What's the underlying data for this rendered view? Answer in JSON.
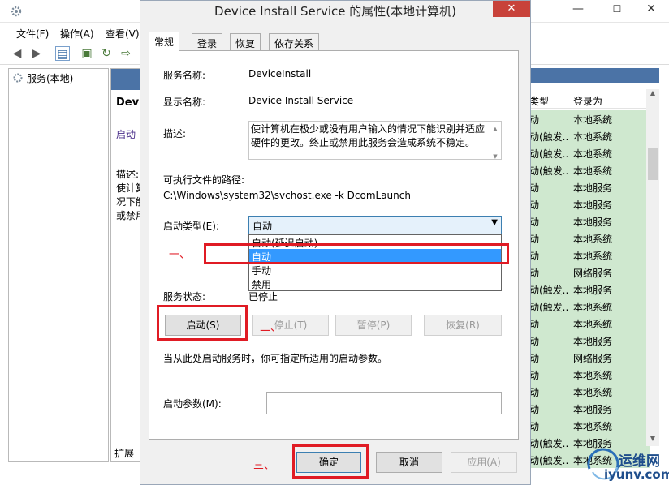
{
  "background_window": {
    "menus": [
      "文件(F)",
      "操作(A)",
      "查看(V)"
    ],
    "tree_item": "服务(本地)",
    "center_title": "Devi",
    "center_link": "启动",
    "center_desc": [
      "描述:",
      "使计算",
      "况下能",
      "或禁用"
    ],
    "extended_tab": "扩展",
    "columns": {
      "type": "类型",
      "logon": "登录为"
    },
    "rows": [
      {
        "type": "动",
        "logon": "本地系统"
      },
      {
        "type": "动(触发...",
        "logon": "本地系统"
      },
      {
        "type": "动(触发...",
        "logon": "本地系统"
      },
      {
        "type": "动(触发...",
        "logon": "本地系统"
      },
      {
        "type": "动",
        "logon": "本地服务"
      },
      {
        "type": "动",
        "logon": "本地服务"
      },
      {
        "type": "动",
        "logon": "本地服务"
      },
      {
        "type": "动",
        "logon": "本地系统"
      },
      {
        "type": "动",
        "logon": "本地系统"
      },
      {
        "type": "动",
        "logon": "网络服务"
      },
      {
        "type": "动(触发...",
        "logon": "本地服务"
      },
      {
        "type": "动(触发...",
        "logon": "本地系统"
      },
      {
        "type": "动",
        "logon": "本地系统"
      },
      {
        "type": "动",
        "logon": "本地服务"
      },
      {
        "type": "动",
        "logon": "网络服务"
      },
      {
        "type": "动",
        "logon": "本地系统"
      },
      {
        "type": "动",
        "logon": "本地系统"
      },
      {
        "type": "动",
        "logon": "本地服务"
      },
      {
        "type": "动",
        "logon": "本地系统"
      },
      {
        "type": "动(触发...",
        "logon": "本地服务"
      },
      {
        "type": "动(触发...",
        "logon": "本地系统"
      }
    ]
  },
  "dialog": {
    "title": "Device Install Service 的属性(本地计算机)",
    "close": "✕",
    "tabs": [
      "常规",
      "登录",
      "恢复",
      "依存关系"
    ],
    "service_name_label": "服务名称:",
    "service_name": "DeviceInstall",
    "display_name_label": "显示名称:",
    "display_name": "Device Install Service",
    "description_label": "描述:",
    "description": "使计算机在极少或没有用户输入的情况下能识别并适应硬件的更改。终止或禁用此服务会造成系统不稳定。",
    "exe_path_label": "可执行文件的路径:",
    "exe_path": "C:\\Windows\\system32\\svchost.exe -k DcomLaunch",
    "startup_type_label": "启动类型(E):",
    "startup_type_value": "自动",
    "startup_options": [
      "自动(延迟启动)",
      "自动",
      "手动",
      "禁用"
    ],
    "startup_selected_index": 1,
    "service_status_label": "服务状态:",
    "service_status": "已停止",
    "buttons": {
      "start": "启动(S)",
      "stop": "停止(T)",
      "pause": "暂停(P)",
      "resume": "恢复(R)"
    },
    "hint": "当从此处启动服务时，你可指定所适用的启动参数。",
    "start_params_label": "启动参数(M):",
    "start_params_value": "",
    "footer": {
      "ok": "确定",
      "cancel": "取消",
      "apply": "应用(A)"
    }
  },
  "annotations": {
    "step1": "一、",
    "step2": "二、",
    "step3": "三、",
    "color": "#e01b24"
  },
  "watermark": {
    "line1": "运维网",
    "line2": "iyunv.com"
  }
}
